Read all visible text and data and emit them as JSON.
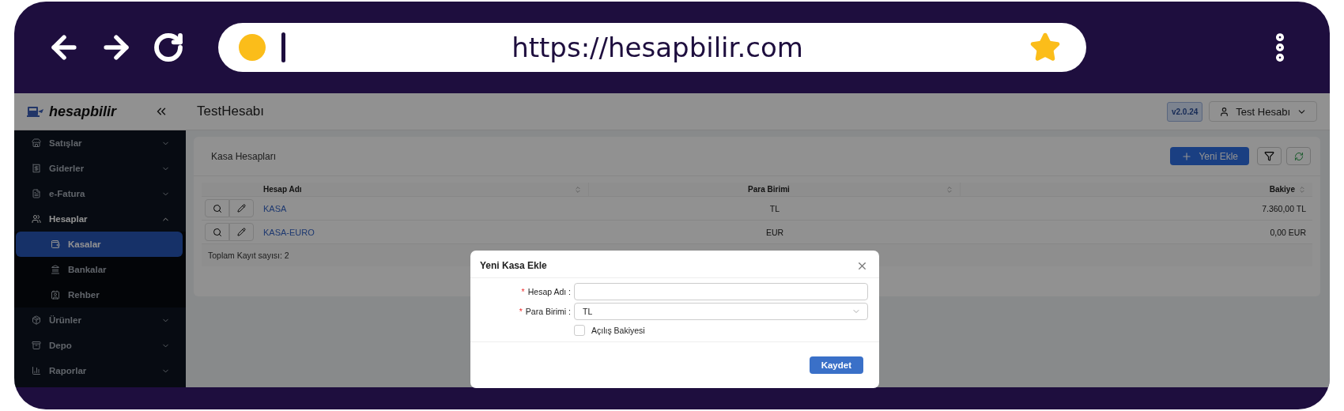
{
  "browser": {
    "url": "https://hesapbilir.com"
  },
  "header": {
    "logo": "hesapbilir",
    "page_title": "TestHesabı",
    "version": "v2.0.24",
    "user": "Test Hesabı"
  },
  "sidebar": {
    "items": [
      {
        "label": "Satışlar",
        "expanded": false,
        "selected": false
      },
      {
        "label": "Giderler",
        "expanded": false,
        "selected": false
      },
      {
        "label": "e-Fatura",
        "expanded": false,
        "selected": false
      },
      {
        "label": "Hesaplar",
        "expanded": true,
        "selected": false,
        "children": [
          {
            "label": "Kasalar",
            "selected": true
          },
          {
            "label": "Bankalar",
            "selected": false
          },
          {
            "label": "Rehber",
            "selected": false
          }
        ]
      },
      {
        "label": "Ürünler",
        "expanded": false,
        "selected": false
      },
      {
        "label": "Depo",
        "expanded": false,
        "selected": false
      },
      {
        "label": "Raporlar",
        "expanded": false,
        "selected": false
      }
    ]
  },
  "card": {
    "title": "Kasa Hesapları",
    "add_button": "Yeni Ekle",
    "table": {
      "columns": [
        "Hesap Adı",
        "Para Birimi",
        "Bakiye"
      ],
      "rows": [
        [
          "KASA",
          "TL",
          "7.360,00 TL"
        ],
        [
          "KASA-EURO",
          "EUR",
          "0,00 EUR"
        ]
      ],
      "footer": "Toplam Kayıt sayısı: 2"
    }
  },
  "modal": {
    "title": "Yeni Kasa Ekle",
    "fields": [
      {
        "kind": "input",
        "label": "Hesap Adı :",
        "required_mark": "*"
      },
      {
        "kind": "select",
        "label": "Para Birimi :",
        "required_mark": "*",
        "value": "TL"
      }
    ],
    "checkbox": {
      "label": "Açılış Bakiyesi",
      "checked": false
    },
    "save_button": "Kaydet"
  }
}
